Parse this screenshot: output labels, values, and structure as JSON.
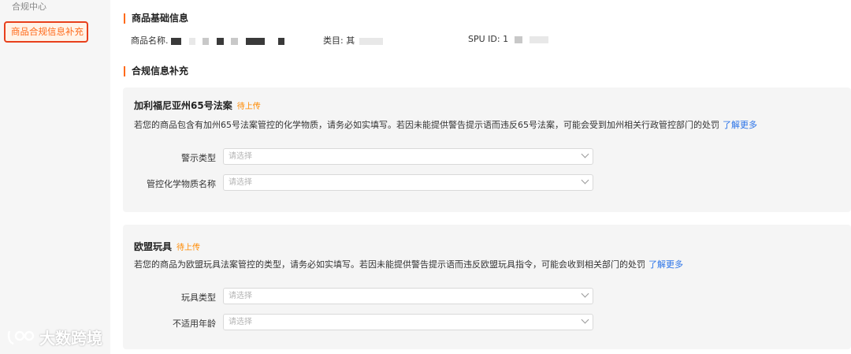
{
  "sidebar": {
    "group_title": "合规中心",
    "active_item": "商品合规信息补充"
  },
  "watermark": {
    "text": "大数跨境"
  },
  "basic_info": {
    "title": "商品基础信息",
    "product_name_label": "商品名称.",
    "category_label": "类目: 其",
    "spu_label": "SPU ID: 1"
  },
  "compliance": {
    "title": "合规信息补充",
    "cards": [
      {
        "title": "加利福尼亚州65号法案",
        "badge": "待上传",
        "desc": "若您的商品包含有加州65号法案管控的化学物质，请务必如实填写。若因未能提供警告提示语而违反65号法案，可能会受到加州相关行政管控部门的处罚",
        "link": "了解更多",
        "fields": [
          {
            "label": "警示类型",
            "placeholder": "请选择"
          },
          {
            "label": "管控化学物质名称",
            "placeholder": "请选择"
          }
        ]
      },
      {
        "title": "欧盟玩具",
        "badge": "待上传",
        "desc": "若您的商品为欧盟玩具法案管控的类型，请务必如实填写。若因未能提供警告提示语而违反欧盟玩具指令，可能会收到相关部门的处罚",
        "link": "了解更多",
        "fields": [
          {
            "label": "玩具类型",
            "placeholder": "请选择"
          },
          {
            "label": "不适用年龄",
            "placeholder": "请选择"
          }
        ]
      }
    ]
  },
  "colors": {
    "accent": "#ff6a1a",
    "link": "#2a73e8",
    "badge": "#ff8a00"
  }
}
